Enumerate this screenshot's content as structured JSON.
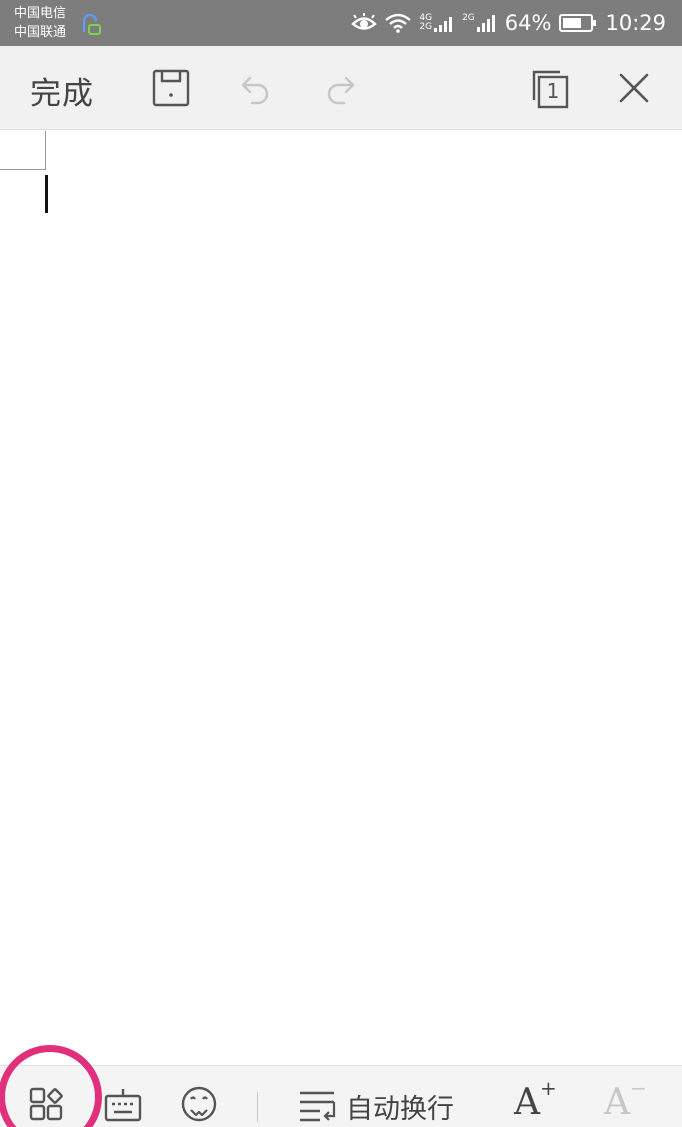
{
  "status_bar": {
    "carrier_1": "中国电信",
    "carrier_2": "中国联通",
    "network_1": "4G",
    "network_1b": "2G",
    "network_2": "2G",
    "battery": "64%",
    "time": "10:29"
  },
  "toolbar": {
    "done_label": "完成",
    "page_count": "1",
    "icons": [
      "save-icon",
      "undo-icon",
      "redo-icon",
      "page-view-icon",
      "close-icon"
    ]
  },
  "bottom_bar": {
    "wrap_label": "自动换行",
    "font_increase_label": "A",
    "font_decrease_label": "A",
    "plus_sign": "+",
    "minus_sign": "−",
    "icons": [
      "apps-grid-icon",
      "keyboard-icon",
      "emoji-icon",
      "word-wrap-icon"
    ]
  },
  "colors": {
    "status_bar": "#7d7d7d",
    "toolbar": "#f1f1f1",
    "highlight_ring": "#e0307c",
    "disabled": "#c7c7c7"
  }
}
